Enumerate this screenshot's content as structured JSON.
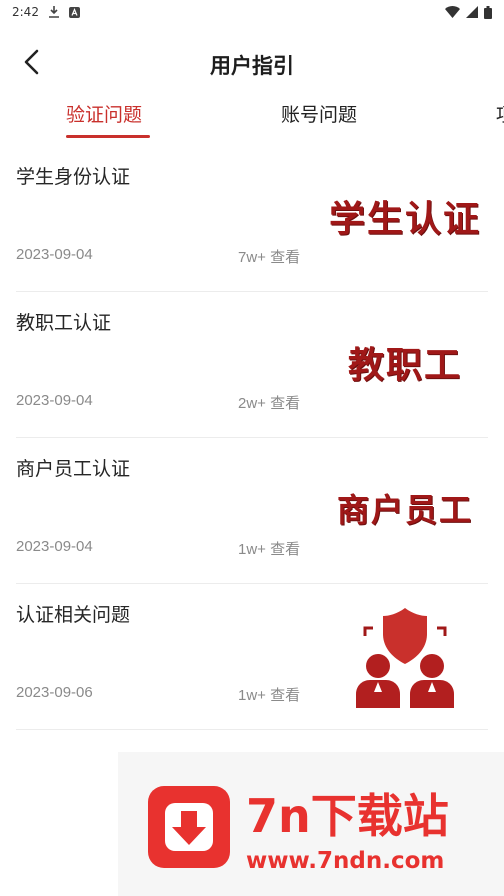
{
  "status_bar": {
    "time": "2:42",
    "icons": [
      "download-icon",
      "app-a-icon",
      "wifi-icon",
      "signal-icon",
      "battery-icon"
    ]
  },
  "header": {
    "title": "用户指引",
    "back_icon": "chevron-left-icon"
  },
  "tabs": [
    {
      "label": "验证问题",
      "active": true
    },
    {
      "label": "账号问题",
      "active": false
    },
    {
      "label": "项",
      "active": false
    }
  ],
  "colors": {
    "accent": "#c9302c",
    "thumb_red": "#a01818",
    "watermark_red": "#e8322f",
    "muted_text": "#8a8a8a"
  },
  "items": [
    {
      "title": "学生身份认证",
      "date": "2023-09-04",
      "views": "7w+ 查看",
      "thumb_text": "学生认证"
    },
    {
      "title": "教职工认证",
      "date": "2023-09-04",
      "views": "2w+ 查看",
      "thumb_text": "教职工"
    },
    {
      "title": "商户员工认证",
      "date": "2023-09-04",
      "views": "1w+ 查看",
      "thumb_text": "商户员工"
    },
    {
      "title": "认证相关问题",
      "date": "2023-09-06",
      "views": "1w+ 查看",
      "thumb_icon": "verified-users-icon"
    }
  ],
  "watermark": {
    "name": "7n下载站",
    "url": "www.7ndn.com",
    "logo_icon": "download-arrow-icon"
  }
}
